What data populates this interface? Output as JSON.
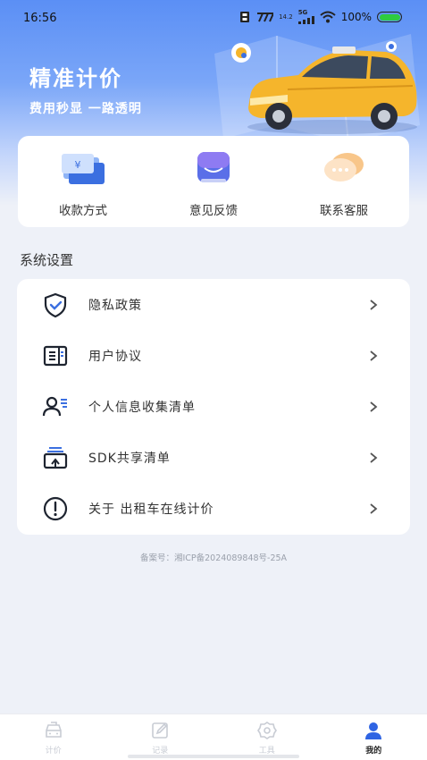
{
  "status_bar": {
    "time": "16:56",
    "network_speed": "14.2",
    "network_type": "5G",
    "battery": "100%"
  },
  "hero": {
    "title": "精准计价",
    "subtitle": "费用秒显 一路透明"
  },
  "quick_actions": [
    {
      "label": "收款方式",
      "icon": "payment-method-icon"
    },
    {
      "label": "意见反馈",
      "icon": "feedback-icon"
    },
    {
      "label": "联系客服",
      "icon": "customer-service-icon"
    }
  ],
  "settings": {
    "title": "系统设置",
    "items": [
      {
        "label": "隐私政策",
        "icon": "shield-check-icon"
      },
      {
        "label": "用户协议",
        "icon": "document-icon"
      },
      {
        "label": "个人信息收集清单",
        "icon": "user-list-icon"
      },
      {
        "label": "SDK共享清单",
        "icon": "sdk-share-icon"
      },
      {
        "label": "关于 出租车在线计价",
        "icon": "info-icon"
      }
    ]
  },
  "footer": {
    "icp": "备案号：湘ICP备2024089848号-25A"
  },
  "tabbar": {
    "tabs": [
      {
        "label": "计价",
        "icon": "taxi-icon",
        "active": false
      },
      {
        "label": "记录",
        "icon": "edit-record-icon",
        "active": false
      },
      {
        "label": "工具",
        "icon": "gear-icon",
        "active": false
      },
      {
        "label": "我的",
        "icon": "user-icon",
        "active": true
      }
    ]
  },
  "colors": {
    "accent": "#3b6fe0",
    "hero_top": "#5b8ff5",
    "background": "#eef1f8",
    "battery": "#2ecc40"
  }
}
